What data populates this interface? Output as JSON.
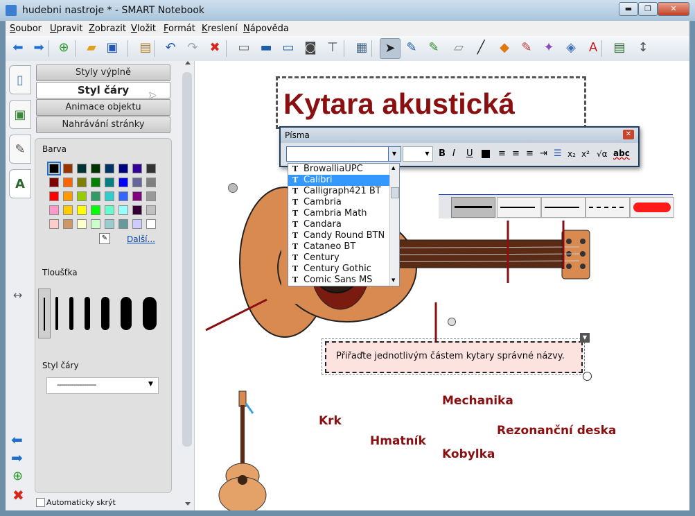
{
  "window": {
    "title": "hudebni nastroje * - SMART Notebook",
    "min": "▬",
    "max": "❐",
    "close": "✕"
  },
  "menu": [
    "Soubor",
    "Upravit",
    "Zobrazit",
    "Vložit",
    "Formát",
    "Kreslení",
    "Nápověda"
  ],
  "toolbar": [
    {
      "name": "back-icon",
      "glyph": "⬅",
      "color": "#1f6fd1"
    },
    {
      "name": "forward-icon",
      "glyph": "➡",
      "color": "#1f6fd1"
    },
    {
      "name": "add-page-icon",
      "glyph": "⊕",
      "color": "#2a9a2a"
    },
    {
      "name": "open-folder-icon",
      "glyph": "▰",
      "color": "#e0a020"
    },
    {
      "name": "save-icon",
      "glyph": "▣",
      "color": "#2458b8"
    },
    {
      "name": "paste-icon",
      "glyph": "▤",
      "color": "#b07a2c"
    },
    {
      "name": "undo-icon",
      "glyph": "↶",
      "color": "#2458b8"
    },
    {
      "name": "redo-icon",
      "glyph": "↷",
      "color": "#9aa7b5"
    },
    {
      "name": "delete-icon",
      "glyph": "✖",
      "color": "#d6261c"
    },
    {
      "name": "screen-shade-icon",
      "glyph": "▭",
      "color": "#6b6b6b"
    },
    {
      "name": "full-screen-icon",
      "glyph": "▬",
      "color": "#1d5fa8"
    },
    {
      "name": "dual-page-icon",
      "glyph": "▭",
      "color": "#1d5fa8"
    },
    {
      "name": "capture-icon",
      "glyph": "◙",
      "color": "#444"
    },
    {
      "name": "document-camera-icon",
      "glyph": "⊤",
      "color": "#444"
    },
    {
      "name": "table-icon",
      "glyph": "▦",
      "color": "#4a6a8a"
    },
    {
      "name": "select-icon",
      "glyph": "➤",
      "color": "#222"
    },
    {
      "name": "pen-icon",
      "glyph": "✎",
      "color": "#1d5fa8"
    },
    {
      "name": "creative-pen-icon",
      "glyph": "✎",
      "color": "#2d8a2d"
    },
    {
      "name": "eraser-icon",
      "glyph": "▱",
      "color": "#888"
    },
    {
      "name": "line-icon",
      "glyph": "╱",
      "color": "#222"
    },
    {
      "name": "shapes-icon",
      "glyph": "◆",
      "color": "#e07a10"
    },
    {
      "name": "magic-pen-icon",
      "glyph": "✎",
      "color": "#c03a3a"
    },
    {
      "name": "magic-wand-icon",
      "glyph": "✦",
      "color": "#8a4ac0"
    },
    {
      "name": "fill-icon",
      "glyph": "◈",
      "color": "#3a6fb8"
    },
    {
      "name": "text-icon",
      "glyph": "A",
      "color": "#c01818"
    },
    {
      "name": "properties-icon",
      "glyph": "▤",
      "color": "#2c6a2c"
    },
    {
      "name": "move-toolbar-icon",
      "glyph": "↕",
      "color": "#555"
    }
  ],
  "props": {
    "tabs": [
      "Styly výplně",
      "Styl čáry",
      "Animace objektu",
      "Nahrávání stránky"
    ],
    "color_label": "Barva",
    "more_link": "Další...",
    "thickness_label": "Tloušťka",
    "linestyle_label": "Styl čáry",
    "linestyle_value": "-------------------",
    "auto_hide": "Automaticky skrýt",
    "swatches": [
      "#000000",
      "#993300",
      "#003333",
      "#003300",
      "#003366",
      "#000080",
      "#330099",
      "#333333",
      "#800000",
      "#ff6600",
      "#808000",
      "#008000",
      "#008080",
      "#0000ff",
      "#666699",
      "#808080",
      "#ff0000",
      "#ff9900",
      "#99cc00",
      "#339966",
      "#33cccc",
      "#3366ff",
      "#800080",
      "#999999",
      "#ff99cc",
      "#ffcc00",
      "#ffff00",
      "#00ff00",
      "#66ffcc",
      "#99ffff",
      "#330033",
      "#c0c0c0",
      "#ffcccc",
      "#cc9966",
      "#ffffcc",
      "#ccffcc",
      "#99cccc",
      "#669999",
      "#ccccff",
      "#ffffff"
    ]
  },
  "canvas": {
    "title": "Kytara akustická",
    "instruction": "Přiřaďte jednotlivým částem kytary správné názvy.",
    "labels": {
      "mechanika": "Mechanika",
      "krk": "Krk",
      "hmatnik": "Hmatník",
      "rezonancni": "Rezonanční deska",
      "kobylka": "Kobylka"
    }
  },
  "font_dialog": {
    "title": "Písma",
    "font_value": "",
    "size_value": "",
    "bold": "B",
    "italic": "I",
    "underline": "U",
    "sub": "x₂",
    "sup": "x²",
    "root": "√α",
    "spell": "abc",
    "fonts": [
      "BrowalliaUPC",
      "Calibri",
      "Calligraph421 BT",
      "Cambria",
      "Cambria Math",
      "Candara",
      "Candy Round BTN",
      "Cataneo BT",
      "Century",
      "Century Gothic",
      "Comic Sans MS"
    ],
    "selected_index": 1
  },
  "colors": {
    "title_red": "#8a0f10",
    "label_red": "#8a0f10",
    "selection_blue": "#3399ff",
    "dialog_border": "#1c3e5c"
  }
}
